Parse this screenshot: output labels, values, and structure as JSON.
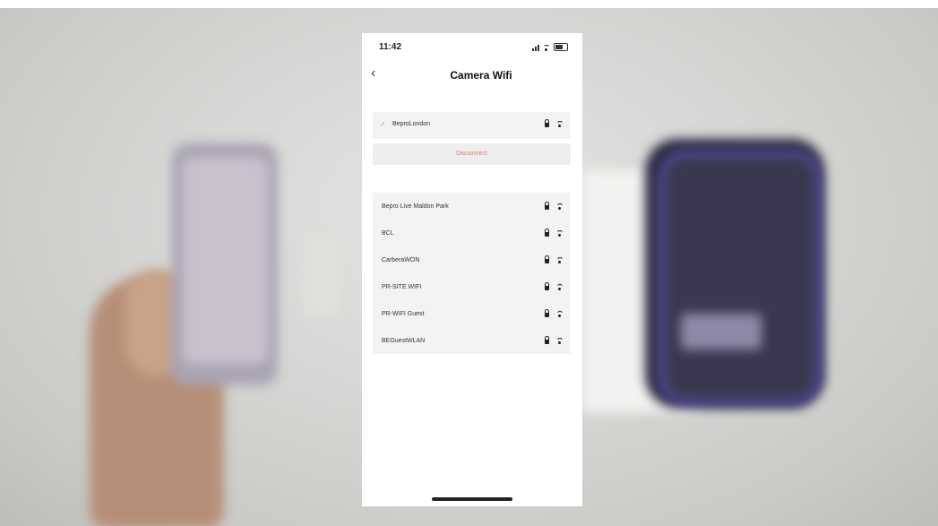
{
  "status_bar": {
    "time": "11:42"
  },
  "nav": {
    "back_icon": "chevron-left-icon",
    "title": "Camera Wifi"
  },
  "connected_network": {
    "name": "BeproLondon",
    "secured": true
  },
  "disconnect_label": "Disconnect",
  "networks": [
    {
      "name": "Bepro Live Maldon Park",
      "secured": true
    },
    {
      "name": "BCL",
      "secured": true
    },
    {
      "name": "CarberaWON",
      "secured": true
    },
    {
      "name": "PR-SITE WIFI",
      "secured": true
    },
    {
      "name": "PR-WIFI Guest",
      "secured": true
    },
    {
      "name": "BEGuestWLAN",
      "secured": true
    }
  ],
  "colors": {
    "disconnect_text": "#e07a7a",
    "device_accent": "#5d56b5"
  }
}
